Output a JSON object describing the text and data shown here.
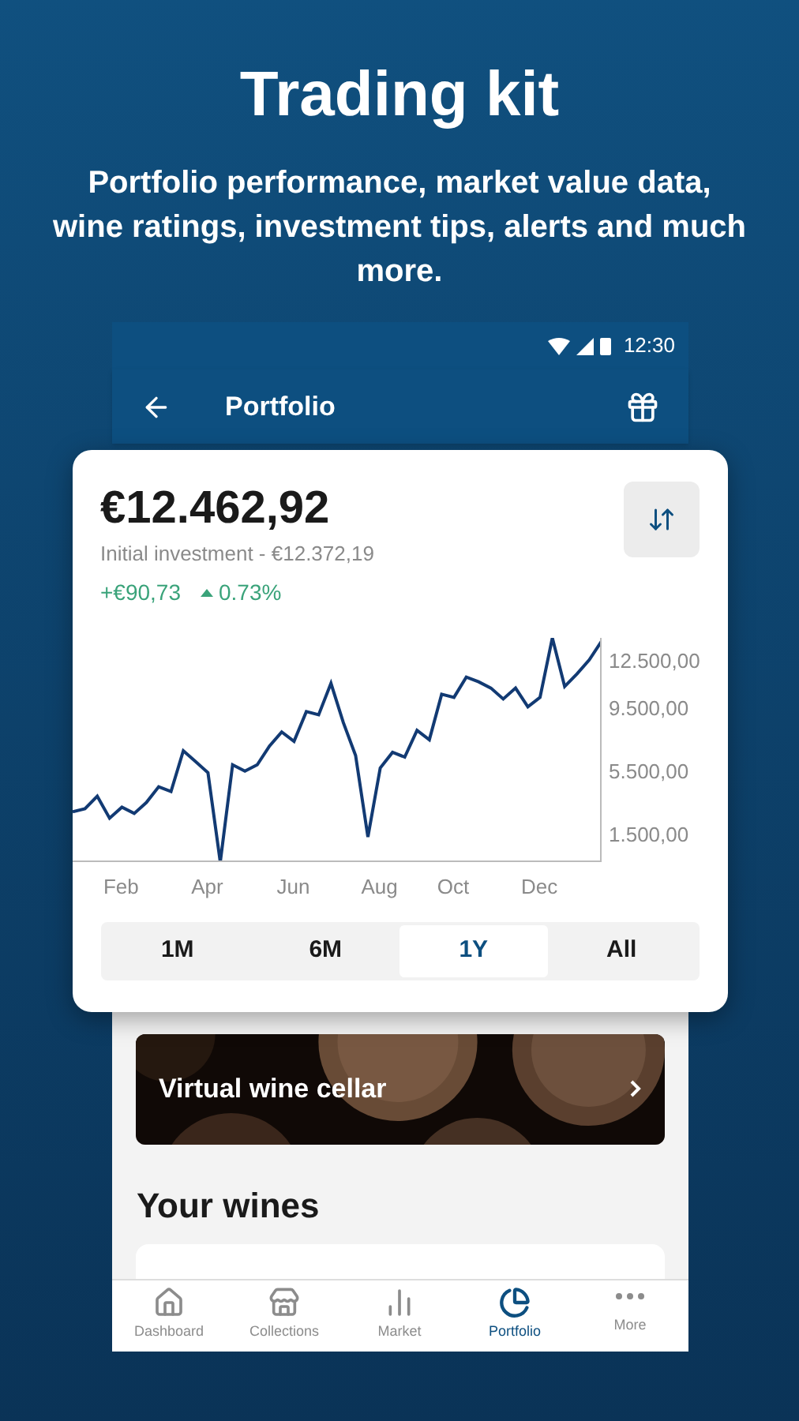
{
  "headline": {
    "title": "Trading kit",
    "subtitle": "Portfolio performance, market value data, wine ratings, investment tips, alerts and much more."
  },
  "status_bar": {
    "time": "12:30"
  },
  "app_bar": {
    "title": "Portfolio"
  },
  "summary": {
    "value": "€12.462,92",
    "initial": "Initial investment - €12.372,19",
    "gain": "+€90,73",
    "change": "0.73%",
    "change_up": true
  },
  "chart": {
    "chart_data": {
      "type": "line",
      "ylim": [
        -200,
        14100
      ],
      "categories": [
        null,
        null,
        null,
        null,
        "Feb",
        null,
        null,
        null,
        null,
        null,
        null,
        "Apr",
        null,
        null,
        null,
        null,
        null,
        null,
        "Jun",
        null,
        null,
        null,
        null,
        null,
        null,
        "Aug",
        null,
        null,
        null,
        null,
        null,
        "Oct",
        null,
        null,
        null,
        null,
        null,
        null,
        "Dec",
        null,
        null,
        null,
        null,
        null
      ],
      "yticks": [
        {
          "value": 12500,
          "label": "12.500,00"
        },
        {
          "value": 9500,
          "label": "9.500,00"
        },
        {
          "value": 5500,
          "label": "5.500,00"
        },
        {
          "value": 1500,
          "label": "1.500,00"
        }
      ],
      "series": [
        {
          "color": "#123a73",
          "values": [
            3000,
            3200,
            4000,
            2600,
            3300,
            2900,
            3600,
            4600,
            4300,
            6900,
            6200,
            5500,
            -200,
            6000,
            5600,
            6000,
            7200,
            8100,
            7500,
            9400,
            9200,
            11200,
            8700,
            6600,
            1400,
            5800,
            6800,
            6500,
            8200,
            7600,
            10500,
            10300,
            11600,
            11300,
            10900,
            10200,
            10900,
            9700,
            10300,
            14100,
            11000,
            11800,
            12700,
            13900
          ]
        }
      ]
    }
  },
  "ranges": [
    {
      "label": "1M",
      "selected": false
    },
    {
      "label": "6M",
      "selected": false
    },
    {
      "label": "1Y",
      "selected": true
    },
    {
      "label": "All",
      "selected": false
    }
  ],
  "banner": {
    "label": "Virtual wine cellar",
    "kind": "picture"
  },
  "section_title": "Your wines",
  "nav": [
    {
      "label": "Dashboard",
      "kind": "home",
      "selected": false
    },
    {
      "label": "Collections",
      "kind": "collections",
      "selected": false
    },
    {
      "label": "Market",
      "kind": "market",
      "selected": false
    },
    {
      "label": "Portfolio",
      "kind": "portfolio",
      "selected": true
    },
    {
      "label": "More",
      "kind": "more",
      "selected": false
    }
  ]
}
